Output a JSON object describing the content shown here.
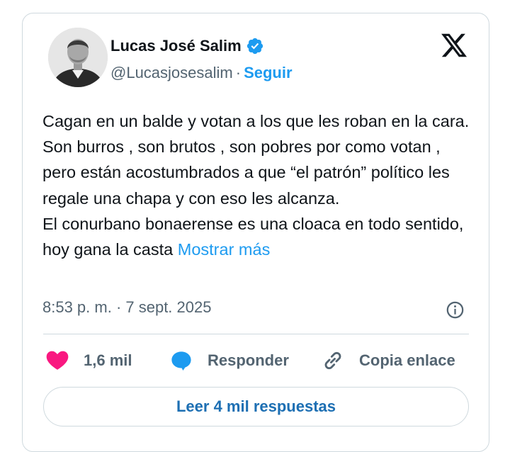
{
  "author": {
    "name": "Lucas José Salim",
    "handle": "@Lucasjosesalim",
    "separator": "·",
    "follow_label": "Seguir",
    "verified": true
  },
  "platform_icon": "x-logo-icon",
  "tweet": {
    "paragraph1": "Cagan en un balde y votan a los que les roban en la cara. Son burros , son brutos , son pobres por como votan , pero están acostumbrados a que “el patrón” político les regale una chapa y con eso les alcanza.",
    "paragraph2": "El conurbano bonaerense es una cloaca en todo sentido, hoy gana la casta ",
    "show_more": "Mostrar más"
  },
  "timestamp": "8:53 p. m. · 7 sept. 2025",
  "actions": {
    "like_count": "1,6 mil",
    "reply_label": "Responder",
    "copy_label": "Copia enlace"
  },
  "replies_button": "Leer 4 mil respuestas",
  "colors": {
    "accent": "#1d9bf0",
    "like": "#f91880",
    "text": "#0f1419",
    "muted": "#536471",
    "border": "#cfd9de"
  },
  "icons": [
    "verified-badge-icon",
    "x-logo-icon",
    "info-icon",
    "heart-icon",
    "reply-bubble-icon",
    "link-icon"
  ]
}
